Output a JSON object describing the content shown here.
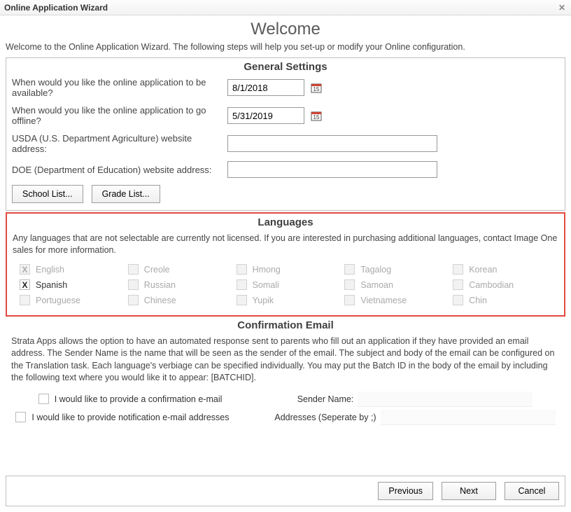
{
  "window": {
    "title": "Online Application Wizard"
  },
  "header": {
    "title": "Welcome",
    "intro": "Welcome to the Online Application Wizard. The following steps will help you set-up or modify your Online configuration."
  },
  "general": {
    "title": "General Settings",
    "q_available": "When would you like the online application to be available?",
    "q_offline": "When would you like the online application to go offline?",
    "date_available": "8/1/2018",
    "date_offline": "5/31/2019",
    "q_usda": "USDA (U.S. Department Agriculture) website address:",
    "q_doe": "DOE (Department of Education) website address:",
    "usda_value": "",
    "doe_value": "",
    "btn_school": "School List...",
    "btn_grade": "Grade List..."
  },
  "languages": {
    "title": "Languages",
    "desc": "Any languages that are not selectable are currently not licensed. If you are interested in purchasing additional languages, contact Image One sales for more information.",
    "items": [
      {
        "label": "English",
        "enabled": false,
        "checked": true
      },
      {
        "label": "Creole",
        "enabled": false,
        "checked": false
      },
      {
        "label": "Hmong",
        "enabled": false,
        "checked": false
      },
      {
        "label": "Tagalog",
        "enabled": false,
        "checked": false
      },
      {
        "label": "Korean",
        "enabled": false,
        "checked": false
      },
      {
        "label": "Spanish",
        "enabled": true,
        "checked": true
      },
      {
        "label": "Russian",
        "enabled": false,
        "checked": false
      },
      {
        "label": "Somali",
        "enabled": false,
        "checked": false
      },
      {
        "label": "Samoan",
        "enabled": false,
        "checked": false
      },
      {
        "label": "Cambodian",
        "enabled": false,
        "checked": false
      },
      {
        "label": "Portuguese",
        "enabled": false,
        "checked": false
      },
      {
        "label": "Chinese",
        "enabled": false,
        "checked": false
      },
      {
        "label": "Yupik",
        "enabled": false,
        "checked": false
      },
      {
        "label": "Vietnamese",
        "enabled": false,
        "checked": false
      },
      {
        "label": "Chin",
        "enabled": false,
        "checked": false
      }
    ]
  },
  "confirmation": {
    "title": "Confirmation Email",
    "desc": "Strata Apps allows the option to have an automated response sent to parents who fill out an application if they have provided an email address. The Sender Name is the name that will be seen as the sender of the email. The subject and body of the email can be configured on the Translation task. Each language's verbiage can be specified individually. You may put the Batch ID in the body of the email by including the following text where you would like it to appear: [BATCHID].",
    "chk_confirm": "I would like to provide a confirmation e-mail",
    "sender_label": "Sender Name:",
    "sender_value": "",
    "chk_notify": "I would like to provide notification e-mail addresses",
    "addr_label": "Addresses (Seperate by ;)",
    "addr_value": ""
  },
  "footer": {
    "previous": "Previous",
    "next": "Next",
    "cancel": "Cancel"
  }
}
